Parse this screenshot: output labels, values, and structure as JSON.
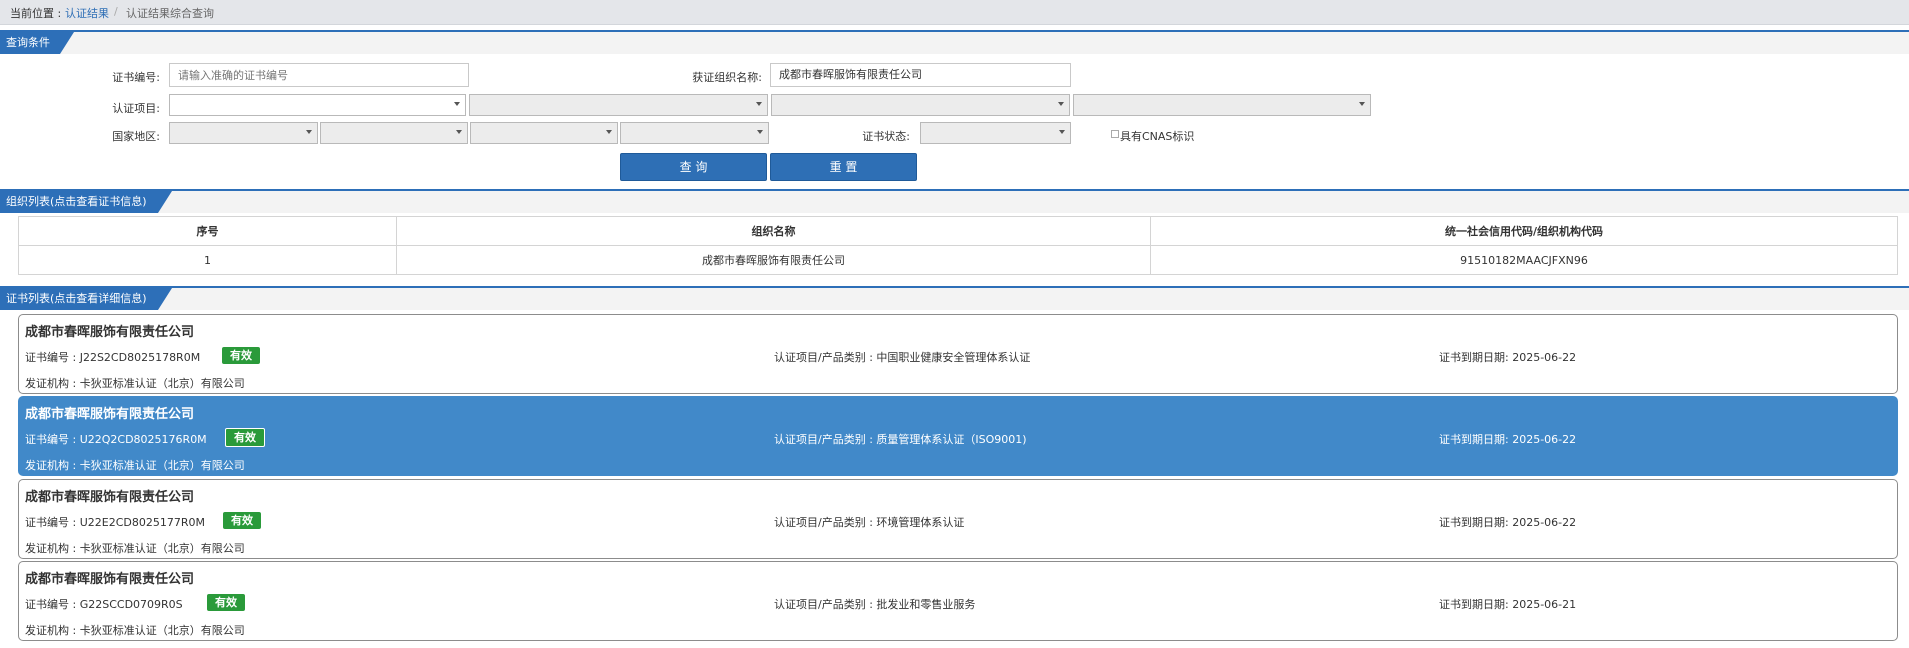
{
  "breadcrumb": {
    "label": "当前位置 :",
    "link": "认证结果",
    "separator": "/",
    "current": "认证结果综合查询"
  },
  "query_section": {
    "title": "查询条件"
  },
  "form": {
    "cert_no_label": "证书编号:",
    "cert_no_placeholder": "请输入准确的证书编号",
    "org_name_label": "获证组织名称:",
    "org_name_value": "成都市春晖服饰有限责任公司",
    "project_label": "认证项目:",
    "region_label": "国家地区:",
    "status_label": "证书状态:",
    "cnas_label": "具有CNAS标识",
    "query_button": "查 询",
    "reset_button": "重 置"
  },
  "org_section": {
    "title": "组织列表(点击查看证书信息)"
  },
  "org_table": {
    "headers": [
      "序号",
      "组织名称",
      "统一社会信用代码/组织机构代码"
    ],
    "rows": [
      [
        "1",
        "成都市春晖服饰有限责任公司",
        "91510182MAACJFXN96"
      ]
    ]
  },
  "cert_section": {
    "title": "证书列表(点击查看详细信息)"
  },
  "certs": [
    {
      "org": "成都市春晖服饰有限责任公司",
      "cert_no": "证书编号 : J22S2CD8025178R0M",
      "status": "有效",
      "project": "认证项目/产品类别 : 中国职业健康安全管理体系认证",
      "expiry": "证书到期日期: 2025-06-22",
      "issuer": "发证机构 : 卡狄亚标准认证（北京）有限公司"
    },
    {
      "org": "成都市春晖服饰有限责任公司",
      "cert_no": "证书编号 : U22Q2CD8025176R0M",
      "status": "有效",
      "project": "认证项目/产品类别 : 质量管理体系认证（ISO9001)",
      "expiry": "证书到期日期: 2025-06-22",
      "issuer": "发证机构 : 卡狄亚标准认证（北京）有限公司"
    },
    {
      "org": "成都市春晖服饰有限责任公司",
      "cert_no": "证书编号 : U22E2CD8025177R0M",
      "status": "有效",
      "project": "认证项目/产品类别 : 环境管理体系认证",
      "expiry": "证书到期日期: 2025-06-22",
      "issuer": "发证机构 : 卡狄亚标准认证（北京）有限公司"
    },
    {
      "org": "成都市春晖服饰有限责任公司",
      "cert_no": "证书编号 : G22SCCD0709R0S",
      "status": "有效",
      "project": "认证项目/产品类别 : 批发业和零售业服务",
      "expiry": "证书到期日期: 2025-06-21",
      "issuer": "发证机构 : 卡狄亚标准认证（北京）有限公司"
    }
  ],
  "colors": {
    "primary": "#2d6fb8",
    "selected_row": "#4189c9",
    "valid_badge": "#2a9a3a"
  }
}
